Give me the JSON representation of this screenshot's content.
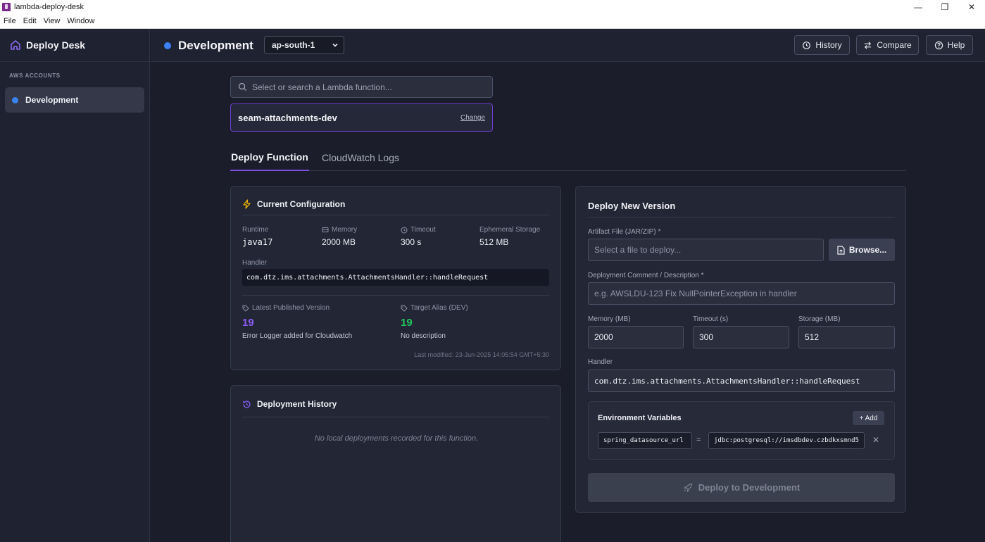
{
  "os": {
    "window_title": "lambda-deploy-desk",
    "menu": [
      "File",
      "Edit",
      "View",
      "Window"
    ]
  },
  "sidebar": {
    "brand": "Deploy Desk",
    "section_title": "AWS ACCOUNTS",
    "accounts": [
      {
        "label": "Development",
        "status_color": "#3b82f6"
      }
    ]
  },
  "header": {
    "environment": "Development",
    "region": "ap-south-1",
    "buttons": {
      "history": "History",
      "compare": "Compare",
      "help": "Help"
    }
  },
  "function_picker": {
    "placeholder": "Select or search a Lambda function...",
    "selected": "seam-attachments-dev",
    "change_label": "Change"
  },
  "tabs": [
    {
      "label": "Deploy Function",
      "active": true
    },
    {
      "label": "CloudWatch Logs",
      "active": false
    }
  ],
  "config": {
    "title": "Current Configuration",
    "runtime_label": "Runtime",
    "runtime": "java17",
    "memory_label": "Memory",
    "memory": "2000 MB",
    "timeout_label": "Timeout",
    "timeout": "300 s",
    "storage_label": "Ephemeral Storage",
    "storage": "512 MB",
    "handler_label": "Handler",
    "handler": "com.dtz.ims.attachments.AttachmentsHandler::handleRequest",
    "latest_version_label": "Latest Published Version",
    "latest_version": "19",
    "latest_version_desc": "Error Logger added for Cloudwatch",
    "alias_label": "Target Alias (DEV)",
    "alias_version": "19",
    "alias_desc": "No description",
    "last_modified": "Last modified: 23-Jun-2025 14:05:54 GMT+5:30"
  },
  "history": {
    "title": "Deployment History",
    "empty": "No local deployments recorded for this function."
  },
  "deploy": {
    "title": "Deploy New Version",
    "artifact_label": "Artifact File (JAR/ZIP) *",
    "artifact_placeholder": "Select a file to deploy...",
    "browse_label": "Browse...",
    "comment_label": "Deployment Comment / Description *",
    "comment_placeholder": "e.g. AWSLDU-123 Fix NullPointerException in handler",
    "memory_label": "Memory (MB)",
    "memory": "2000",
    "timeout_label": "Timeout (s)",
    "timeout": "300",
    "storage_label": "Storage (MB)",
    "storage": "512",
    "handler_label": "Handler",
    "handler": "com.dtz.ims.attachments.AttachmentsHandler::handleRequest",
    "env_title": "Environment Variables",
    "env_add": "+ Add",
    "env_vars": [
      {
        "key": "spring_datasource_url",
        "eq": "=",
        "value": "jdbc:postgresql://imsdbdev.czbdkxsmnd5"
      }
    ],
    "deploy_button": "Deploy to Development"
  },
  "colors": {
    "accent": "#7c4ddf",
    "version": "#8b5cf6",
    "alias": "#22c55e",
    "status": "#3b82f6"
  }
}
